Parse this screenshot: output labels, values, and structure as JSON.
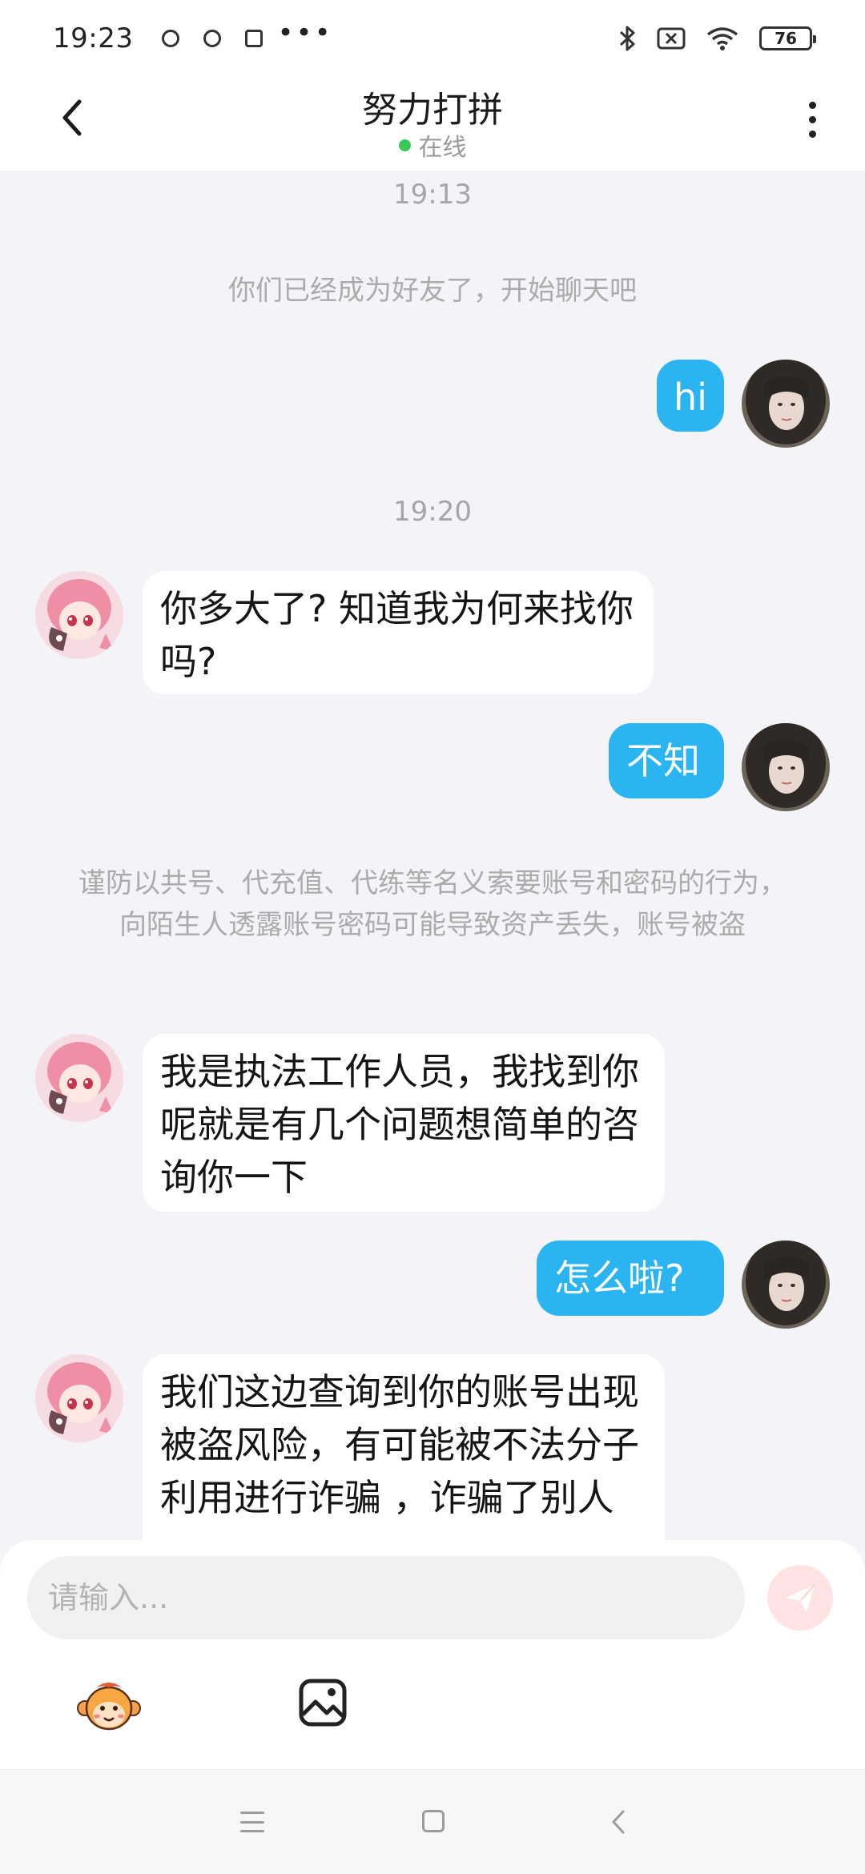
{
  "status_bar": {
    "time": "19:23",
    "app_icons": [
      "app-notify-icon",
      "app-notify-icon",
      "app-notify-icon"
    ],
    "more": "•••",
    "battery": "76"
  },
  "header": {
    "title": "努力打拼",
    "status": "在线",
    "status_color": "#38c75a"
  },
  "chat": {
    "timestamp_1": "19:13",
    "system_friend": "你们已经成为好友了，开始聊天吧",
    "msg_1": "hi",
    "timestamp_2": "19:20",
    "msg_2": "你多大了? 知道我为何来找你吗?",
    "msg_3": "不知",
    "system_warning": "谨防以共号、代充值、代练等名义索要账号和密码的行为，向陌生人透露账号密码可能导致资产丢失，账号被盗",
    "msg_4": "我是执法工作人员，我找到你呢就是有几个问题想简单的咨询你一下",
    "msg_5": "怎么啦?",
    "msg_6": "我们这边查询到你的账号出现被盗风险，有可能被不法分子利用进行诈骗 ，诈骗了别人"
  },
  "input": {
    "placeholder": "请输入..."
  },
  "colors": {
    "outgoing_bubble": "#2ab4f2",
    "incoming_bubble": "#ffffff",
    "background": "#f4f3f7",
    "send_button": "#ffe3e2"
  }
}
